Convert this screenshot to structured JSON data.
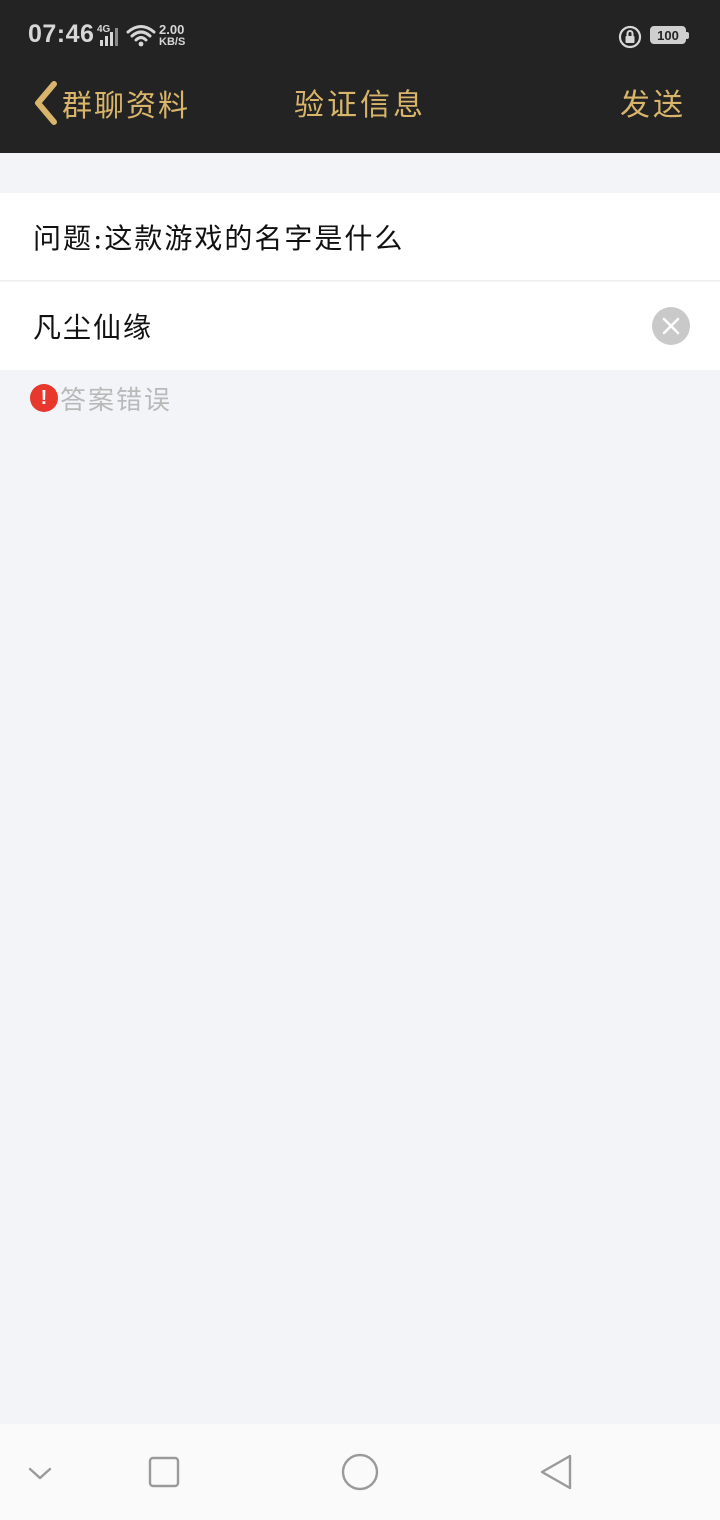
{
  "status_bar": {
    "time": "07:46",
    "network_type": "4G",
    "speed_value": "2.00",
    "speed_unit": "KB/S",
    "battery": "100",
    "icons": [
      "signal-icon",
      "wifi-icon",
      "rotate-lock-icon",
      "battery-icon"
    ]
  },
  "navbar": {
    "back_label": "群聊资料",
    "title": "验证信息",
    "send_label": "发送"
  },
  "form": {
    "question": "问题:这款游戏的名字是什么",
    "answer_value": "凡尘仙缘",
    "error_text": "答案错误"
  },
  "colors": {
    "header_bg": "#232323",
    "accent_gold": "#d8b56a",
    "page_bg": "#f3f4f8",
    "error_red": "#e8372c"
  },
  "system_nav": {
    "icons": [
      "collapse-chevron-icon",
      "recents-square-icon",
      "home-circle-icon",
      "back-triangle-icon"
    ]
  }
}
